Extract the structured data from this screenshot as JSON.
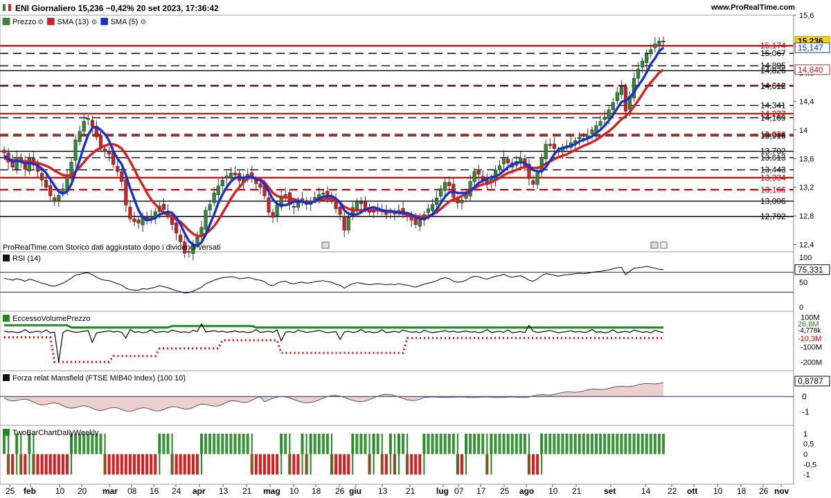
{
  "header": {
    "title": "ENI Giornaliero 15,236 −0,42% 20 set 2023, 17:36:42",
    "site": "www.ProRealTime.com"
  },
  "colors": {
    "up": "#2e8b2e",
    "down": "#d62020",
    "sma13": "#e11b1b",
    "sma5": "#1230d6",
    "rsi": "#000000",
    "ref_line": "#1d22a0",
    "mansfield_fill": "#e9cccc"
  },
  "chart_data": [
    {
      "type": "candlestick",
      "panel": "price",
      "legend": [
        "Prezzo",
        "SMA (13)",
        "SMA (5)"
      ],
      "note": "ProRealTime.com  Storico dati aggiustato dopo i dividendi versati",
      "ylim": [
        12.3,
        15.6
      ],
      "y_ticks": [
        "15,6",
        "15,2",
        "14,8",
        "14,4",
        "14",
        "13,6",
        "13,2",
        "12,8",
        "12,4"
      ],
      "x_ticks": [
        "25",
        "feb",
        "10",
        "20",
        "mar",
        "08",
        "16",
        "24",
        "apr",
        "13",
        "21",
        "mag",
        "10",
        "18",
        "26",
        "giu",
        "13",
        "21",
        "lug",
        "07",
        "17",
        "25",
        "ago",
        "10",
        "21",
        "set",
        "14",
        "22",
        "ott",
        "10",
        "18",
        "26",
        "nov"
      ],
      "last_price": "15,236",
      "sma13_value": "14,840",
      "sma5_value": "15,147",
      "levels": [
        {
          "label": "15,174",
          "color": "red",
          "style": "solid"
        },
        {
          "label": "15,067",
          "color": "black",
          "style": "dashed"
        },
        {
          "label": "14,895",
          "color": "black",
          "style": "dashed"
        },
        {
          "label": "14,826",
          "color": "black",
          "style": "solid"
        },
        {
          "label": "14,618",
          "color": "red",
          "style": "dashed"
        },
        {
          "label": "14,612",
          "color": "black",
          "style": "dashed"
        },
        {
          "label": "14,341",
          "color": "black",
          "style": "dashed"
        },
        {
          "label": "14,227",
          "color": "red",
          "style": "solid"
        },
        {
          "label": "14,169",
          "color": "black",
          "style": "dashed"
        },
        {
          "label": "13,936",
          "color": "red",
          "style": "dashed"
        },
        {
          "label": "13,916",
          "color": "black",
          "style": "dashed"
        },
        {
          "label": "13,702",
          "color": "black",
          "style": "solid"
        },
        {
          "label": "13,613",
          "color": "black",
          "style": "dashed"
        },
        {
          "label": "13,443",
          "color": "black",
          "style": "dashed"
        },
        {
          "label": "13,334",
          "color": "red",
          "style": "solid"
        },
        {
          "label": "13,166",
          "color": "red",
          "style": "dashed"
        },
        {
          "label": "13,006",
          "color": "black",
          "style": "solid"
        },
        {
          "label": "12,792",
          "color": "black",
          "style": "solid"
        }
      ],
      "close": [
        13.68,
        13.55,
        13.48,
        13.62,
        13.55,
        13.45,
        13.6,
        13.51,
        13.42,
        13.3,
        13.2,
        13.08,
        13.02,
        13.09,
        13.18,
        13.35,
        13.55,
        13.86,
        13.98,
        14.12,
        14.16,
        14.05,
        13.9,
        13.76,
        13.7,
        13.66,
        13.52,
        13.42,
        13.28,
        12.95,
        12.76,
        12.72,
        12.7,
        12.78,
        12.73,
        12.79,
        12.86,
        12.94,
        12.89,
        12.82,
        12.68,
        12.56,
        12.44,
        12.28,
        12.3,
        12.4,
        12.5,
        12.64,
        12.88,
        12.96,
        13.12,
        13.22,
        13.3,
        13.36,
        13.4,
        13.37,
        13.29,
        13.32,
        13.38,
        13.33,
        13.25,
        13.2,
        13.08,
        12.85,
        12.78,
        12.95,
        13.08,
        13.1,
        12.96,
        12.92,
        12.98,
        13.04,
        12.96,
        13.0,
        13.06,
        13.1,
        13.12,
        13.08,
        13.02,
        12.9,
        12.82,
        12.6,
        12.78,
        12.92,
        13.0,
        12.97,
        12.9,
        12.85,
        12.89,
        12.91,
        12.86,
        12.82,
        12.86,
        12.84,
        12.88,
        12.83,
        12.8,
        12.74,
        12.68,
        12.74,
        12.82,
        12.9,
        12.96,
        13.05,
        13.18,
        13.27,
        13.22,
        13.06,
        12.98,
        13.02,
        13.1,
        13.28,
        13.42,
        13.38,
        13.3,
        13.24,
        13.33,
        13.44,
        13.5,
        13.62,
        13.54,
        13.48,
        13.56,
        13.6,
        13.5,
        13.32,
        13.24,
        13.4,
        13.62,
        13.8,
        13.78,
        13.74,
        13.69,
        13.74,
        13.78,
        13.82,
        13.85,
        13.9,
        13.88,
        13.92,
        14.0,
        14.06,
        14.12,
        14.18,
        14.28,
        14.38,
        14.52,
        14.6,
        14.26,
        14.47,
        14.72,
        14.85,
        14.96,
        15.06,
        15.12,
        15.2,
        15.24,
        15.236
      ],
      "sma13": [
        13.6,
        13.59,
        13.58,
        13.57,
        13.57,
        13.56,
        13.56,
        13.55,
        13.54,
        13.52,
        13.5,
        13.47,
        13.43,
        13.4,
        13.37,
        13.36,
        13.37,
        13.42,
        13.48,
        13.55,
        13.62,
        13.67,
        13.72,
        13.75,
        13.78,
        13.8,
        13.8,
        13.78,
        13.74,
        13.66,
        13.56,
        13.45,
        13.33,
        13.23,
        13.12,
        13.03,
        12.96,
        12.9,
        12.84,
        12.81,
        12.78,
        12.75,
        12.72,
        12.66,
        12.6,
        12.55,
        12.52,
        12.52,
        12.55,
        12.6,
        12.66,
        12.74,
        12.84,
        12.94,
        13.04,
        13.13,
        13.2,
        13.27,
        13.32,
        13.34,
        13.33,
        13.31,
        13.27,
        13.2,
        13.12,
        13.08,
        13.06,
        13.06,
        13.05,
        13.03,
        13.02,
        13.0,
        12.99,
        12.99,
        13.0,
        13.02,
        13.03,
        13.04,
        13.03,
        13.01,
        12.98,
        12.93,
        12.9,
        12.88,
        12.88,
        12.88,
        12.88,
        12.88,
        12.88,
        12.88,
        12.87,
        12.86,
        12.86,
        12.85,
        12.84,
        12.83,
        12.82,
        12.81,
        12.8,
        12.79,
        12.79,
        12.8,
        12.82,
        12.85,
        12.9,
        12.95,
        13.0,
        13.03,
        13.05,
        13.08,
        13.1,
        13.14,
        13.19,
        13.22,
        13.24,
        13.25,
        13.27,
        13.3,
        13.33,
        13.37,
        13.4,
        13.42,
        13.44,
        13.47,
        13.48,
        13.48,
        13.47,
        13.47,
        13.49,
        13.53,
        13.56,
        13.59,
        13.62,
        13.64,
        13.66,
        13.69,
        13.72,
        13.75,
        13.78,
        13.8,
        13.83,
        13.86,
        13.9,
        13.94,
        13.98,
        14.03,
        14.09,
        14.15,
        14.19,
        14.25,
        14.33,
        14.41,
        14.5,
        14.59,
        14.66,
        14.73,
        14.8,
        14.84
      ],
      "sma5": [
        13.64,
        13.6,
        13.56,
        13.57,
        13.56,
        13.53,
        13.54,
        13.53,
        13.5,
        13.46,
        13.4,
        13.31,
        13.22,
        13.14,
        13.11,
        13.14,
        13.24,
        13.41,
        13.58,
        13.77,
        13.93,
        14.03,
        14.04,
        14.0,
        13.94,
        13.85,
        13.7,
        13.6,
        13.52,
        13.37,
        13.19,
        13.03,
        12.88,
        12.78,
        12.74,
        12.75,
        12.77,
        12.82,
        12.84,
        12.86,
        12.84,
        12.78,
        12.68,
        12.56,
        12.45,
        12.4,
        12.38,
        12.43,
        12.54,
        12.68,
        12.82,
        12.98,
        13.1,
        13.2,
        13.28,
        13.33,
        13.34,
        13.33,
        13.35,
        13.34,
        13.31,
        13.3,
        13.24,
        13.14,
        13.03,
        12.97,
        12.95,
        12.95,
        12.97,
        13.0,
        13.0,
        13.0,
        12.98,
        12.98,
        13.01,
        13.04,
        13.07,
        13.07,
        13.08,
        13.04,
        12.99,
        12.88,
        12.83,
        12.82,
        12.82,
        12.85,
        12.89,
        12.91,
        12.92,
        12.9,
        12.88,
        12.87,
        12.87,
        12.86,
        12.85,
        12.85,
        12.84,
        12.82,
        12.78,
        12.76,
        12.76,
        12.78,
        12.82,
        12.89,
        12.98,
        13.07,
        13.13,
        13.14,
        13.12,
        13.12,
        13.12,
        13.15,
        13.2,
        13.26,
        13.29,
        13.32,
        13.34,
        13.35,
        13.38,
        13.43,
        13.48,
        13.52,
        13.54,
        13.55,
        13.54,
        13.49,
        13.44,
        13.42,
        13.42,
        13.48,
        13.57,
        13.66,
        13.73,
        13.75,
        13.76,
        13.78,
        13.8,
        13.84,
        13.86,
        13.88,
        13.91,
        13.96,
        14.0,
        14.06,
        14.13,
        14.21,
        14.3,
        14.39,
        14.41,
        14.45,
        14.53,
        14.62,
        14.7,
        14.8,
        14.92,
        15.0,
        15.1,
        15.147
      ]
    },
    {
      "type": "line",
      "panel": "rsi",
      "legend": [
        "RSI (14)"
      ],
      "ylim": [
        0,
        100
      ],
      "y_ticks": [
        "100",
        "50",
        "0"
      ],
      "reference_lines": [
        70,
        30
      ],
      "last_value": "75,331",
      "values": [
        58,
        56,
        54,
        57,
        55,
        52,
        56,
        54,
        51,
        48,
        46,
        43,
        42,
        45,
        48,
        53,
        58,
        64,
        66,
        68,
        69,
        65,
        60,
        56,
        54,
        53,
        50,
        47,
        44,
        38,
        35,
        34,
        34,
        37,
        36,
        38,
        40,
        43,
        41,
        39,
        36,
        33,
        31,
        28,
        29,
        32,
        36,
        40,
        47,
        50,
        54,
        57,
        59,
        60,
        61,
        60,
        57,
        58,
        59,
        58,
        55,
        54,
        51,
        45,
        43,
        48,
        51,
        52,
        48,
        47,
        49,
        50,
        48,
        49,
        51,
        52,
        53,
        51,
        50,
        46,
        44,
        38,
        43,
        47,
        49,
        48,
        46,
        45,
        46,
        47,
        46,
        45,
        46,
        45,
        47,
        45,
        44,
        42,
        40,
        43,
        46,
        48,
        50,
        53,
        57,
        59,
        57,
        52,
        50,
        51,
        54,
        59,
        62,
        61,
        58,
        56,
        59,
        62,
        63,
        66,
        62,
        60,
        62,
        63,
        59,
        54,
        52,
        57,
        63,
        67,
        66,
        64,
        62,
        64,
        65,
        66,
        67,
        68,
        67,
        68,
        70,
        71,
        72,
        73,
        75,
        77,
        79,
        80,
        65,
        72,
        78,
        79,
        80,
        82,
        80,
        78,
        76,
        75.331
      ]
    },
    {
      "type": "line",
      "panel": "volume_excess",
      "legend": [
        "EccessoVolumePrezzo"
      ],
      "ylim": [
        -240,
        120
      ],
      "y_ticks": [
        "100M",
        "-100M",
        "-200M"
      ],
      "labels": [
        "26,8M",
        "-4,778k",
        "-10,3M"
      ]
    },
    {
      "type": "area",
      "panel": "mansfield",
      "legend": [
        "Forza relat Mansfield (FTSE MIB40 Index) (100 10)"
      ],
      "ylim": [
        -1.6,
        1.4
      ],
      "y_ticks": [
        "0",
        "-1"
      ],
      "last_value": "0,8787"
    },
    {
      "type": "bar",
      "panel": "twobar",
      "legend": [
        "TwoBarChartDailyWeekly"
      ],
      "ylim": [
        -1.2,
        1.2
      ],
      "y_ticks": [
        "1",
        "0,5",
        "0",
        "-0,5",
        "-1"
      ],
      "last_value": "1"
    }
  ]
}
